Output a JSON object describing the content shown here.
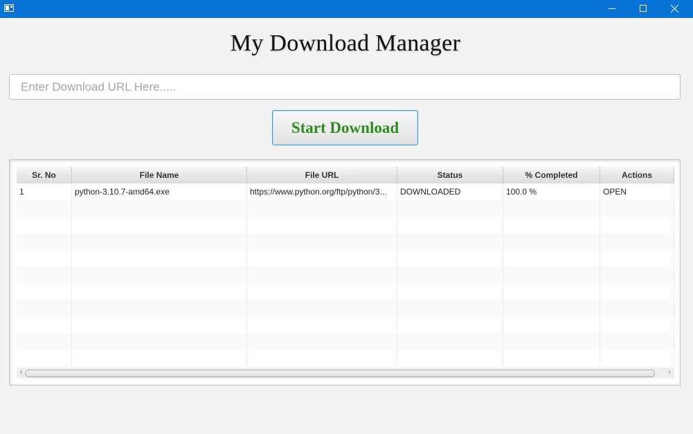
{
  "window": {
    "minimize_icon": "minimize-icon",
    "maximize_icon": "maximize-icon",
    "close_icon": "close-icon"
  },
  "header": {
    "title": "My Download Manager"
  },
  "url_input": {
    "value": "",
    "placeholder": "Enter Download URL Here....."
  },
  "start_button": {
    "label": "Start Download",
    "color": "#2e8b1f"
  },
  "table": {
    "columns": [
      "Sr. No",
      "File Name",
      "File URL",
      "Status",
      "% Completed",
      "Actions"
    ],
    "rows": [
      {
        "sr_no": "1",
        "file_name": "python-3.10.7-amd64.exe",
        "file_url": "https://www.python.org/ftp/python/3...",
        "status": "DOWNLOADED",
        "percent": "100.0 %",
        "action": "OPEN"
      }
    ]
  },
  "colors": {
    "titlebar": "#0a74d6",
    "accent_border": "#3d9ad8"
  }
}
